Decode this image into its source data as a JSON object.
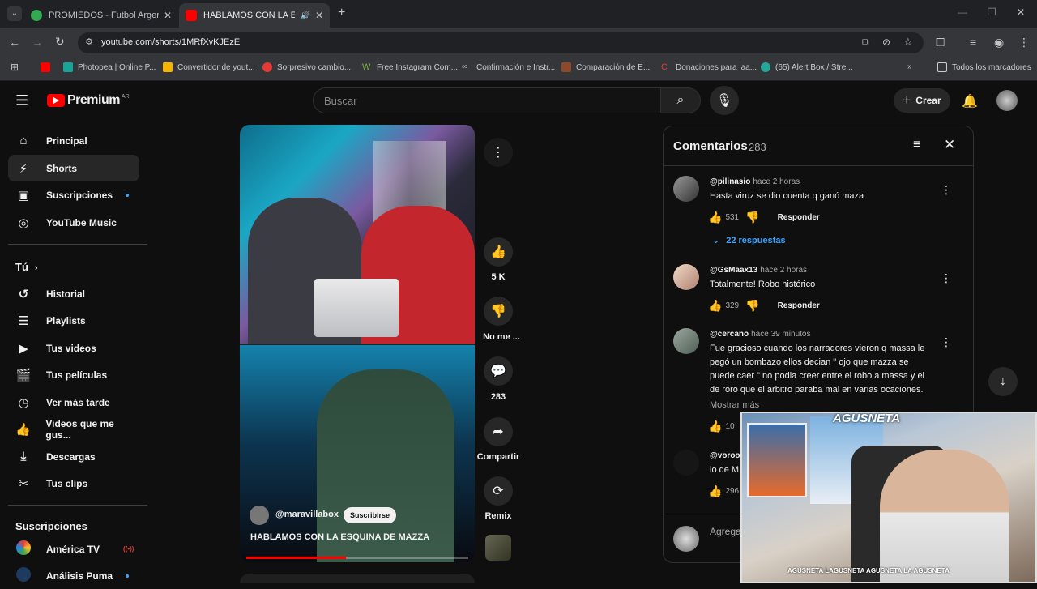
{
  "browser": {
    "tabs": [
      {
        "title": "PROMIEDOS - Futbol Argentino",
        "active": false
      },
      {
        "title": "HABLAMOS CON LA ESQUINA DE MAZZA",
        "active": true
      }
    ],
    "url": "youtube.com/shorts/1MRfXvKJEzE",
    "bookmarks": [
      "Photopea | Online P...",
      "Convertidor de yout...",
      "Sorpresivo cambio...",
      "Free Instagram Com...",
      "Confirmación e Instr...",
      "Comparación de E...",
      "Donaciones para laa...",
      "(65) Alert Box / Stre...",
      "Todos los marcadores"
    ]
  },
  "youtube": {
    "logo": "Premium",
    "region": "AR",
    "search_placeholder": "Buscar",
    "create_label": "Crear",
    "sidebar": {
      "items": [
        {
          "label": "Principal",
          "icon": "home-icon"
        },
        {
          "label": "Shorts",
          "icon": "shorts-icon",
          "selected": true
        },
        {
          "label": "Suscripciones",
          "icon": "subscriptions-icon"
        },
        {
          "label": "YouTube Music",
          "icon": "music-icon"
        }
      ],
      "you_label": "Tú",
      "you_items": [
        {
          "label": "Historial",
          "icon": "history-icon"
        },
        {
          "label": "Playlists",
          "icon": "playlists-icon"
        },
        {
          "label": "Tus videos",
          "icon": "video-icon"
        },
        {
          "label": "Tus películas",
          "icon": "movies-icon"
        },
        {
          "label": "Ver más tarde",
          "icon": "clock-icon"
        },
        {
          "label": "Videos que me gus...",
          "icon": "like-icon"
        },
        {
          "label": "Descargas",
          "icon": "download-icon"
        },
        {
          "label": "Tus clips",
          "icon": "clips-icon"
        }
      ],
      "subs_label": "Suscripciones",
      "subs": [
        {
          "label": "América TV"
        },
        {
          "label": "Análisis Puma"
        }
      ]
    },
    "short": {
      "channel": "@maravillabox",
      "subscribe_label": "Suscribirse",
      "title": "HABLAMOS CON LA ESQUINA DE MAZZA",
      "progress": 0.45,
      "likes": "5 K",
      "dislike_label": "No me ...",
      "comments": "283",
      "share_label": "Compartir",
      "remix_label": "Remix"
    },
    "comments_panel": {
      "title": "Comentarios",
      "count": "283",
      "add_placeholder": "Agrega",
      "comments": [
        {
          "user": "@pilinasio",
          "time": "hace 2 horas",
          "text": "Hasta viruz se dio cuenta q ganó maza",
          "likes": "531",
          "reply_label": "Responder",
          "replies": "22 respuestas"
        },
        {
          "user": "@GsMaax13",
          "time": "hace 2 horas",
          "text": "Totalmente! Robo histórico",
          "likes": "329",
          "reply_label": "Responder"
        },
        {
          "user": "@cercano",
          "time": "hace 39 minutos",
          "text": "Fue gracioso cuando los narradores  vieron q massa le pegó un bombazo  ellos decian \" ojo que mazza se puede caer \"  no podia creer entre el robo a massa y el de roro que el arbitro paraba mal en varias ocaciones.",
          "show_more": "Mostrar más",
          "likes": "10"
        },
        {
          "user": "@voroo",
          "text": "lo de M",
          "likes": "296"
        }
      ]
    }
  },
  "stream_overlay": {
    "brand": "AGUSNETA",
    "socials": "AGUSNETA  LAGUSNETA  AGUSNETA  LA AGUSNETA"
  }
}
